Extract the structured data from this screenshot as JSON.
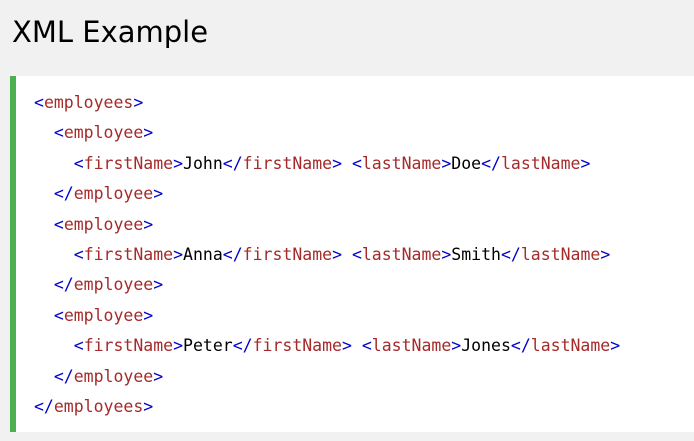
{
  "page": {
    "title": "XML Example"
  },
  "code": {
    "lines": [
      {
        "indent": 0,
        "tokens": [
          {
            "type": "b",
            "text": "<"
          },
          {
            "type": "t",
            "text": "employees"
          },
          {
            "type": "b",
            "text": ">"
          }
        ]
      },
      {
        "indent": 1,
        "tokens": [
          {
            "type": "b",
            "text": "<"
          },
          {
            "type": "t",
            "text": "employee"
          },
          {
            "type": "b",
            "text": ">"
          }
        ]
      },
      {
        "indent": 2,
        "tokens": [
          {
            "type": "b",
            "text": "<"
          },
          {
            "type": "t",
            "text": "firstName"
          },
          {
            "type": "b",
            "text": ">"
          },
          {
            "type": "x",
            "text": "John"
          },
          {
            "type": "b",
            "text": "</"
          },
          {
            "type": "t",
            "text": "firstName"
          },
          {
            "type": "b",
            "text": ">"
          },
          {
            "type": "x",
            "text": " "
          },
          {
            "type": "b",
            "text": "<"
          },
          {
            "type": "t",
            "text": "lastName"
          },
          {
            "type": "b",
            "text": ">"
          },
          {
            "type": "x",
            "text": "Doe"
          },
          {
            "type": "b",
            "text": "</"
          },
          {
            "type": "t",
            "text": "lastName"
          },
          {
            "type": "b",
            "text": ">"
          }
        ]
      },
      {
        "indent": 1,
        "tokens": [
          {
            "type": "b",
            "text": "</"
          },
          {
            "type": "t",
            "text": "employee"
          },
          {
            "type": "b",
            "text": ">"
          }
        ]
      },
      {
        "indent": 1,
        "tokens": [
          {
            "type": "b",
            "text": "<"
          },
          {
            "type": "t",
            "text": "employee"
          },
          {
            "type": "b",
            "text": ">"
          }
        ]
      },
      {
        "indent": 2,
        "tokens": [
          {
            "type": "b",
            "text": "<"
          },
          {
            "type": "t",
            "text": "firstName"
          },
          {
            "type": "b",
            "text": ">"
          },
          {
            "type": "x",
            "text": "Anna"
          },
          {
            "type": "b",
            "text": "</"
          },
          {
            "type": "t",
            "text": "firstName"
          },
          {
            "type": "b",
            "text": ">"
          },
          {
            "type": "x",
            "text": " "
          },
          {
            "type": "b",
            "text": "<"
          },
          {
            "type": "t",
            "text": "lastName"
          },
          {
            "type": "b",
            "text": ">"
          },
          {
            "type": "x",
            "text": "Smith"
          },
          {
            "type": "b",
            "text": "</"
          },
          {
            "type": "t",
            "text": "lastName"
          },
          {
            "type": "b",
            "text": ">"
          }
        ]
      },
      {
        "indent": 1,
        "tokens": [
          {
            "type": "b",
            "text": "</"
          },
          {
            "type": "t",
            "text": "employee"
          },
          {
            "type": "b",
            "text": ">"
          }
        ]
      },
      {
        "indent": 1,
        "tokens": [
          {
            "type": "b",
            "text": "<"
          },
          {
            "type": "t",
            "text": "employee"
          },
          {
            "type": "b",
            "text": ">"
          }
        ]
      },
      {
        "indent": 2,
        "tokens": [
          {
            "type": "b",
            "text": "<"
          },
          {
            "type": "t",
            "text": "firstName"
          },
          {
            "type": "b",
            "text": ">"
          },
          {
            "type": "x",
            "text": "Peter"
          },
          {
            "type": "b",
            "text": "</"
          },
          {
            "type": "t",
            "text": "firstName"
          },
          {
            "type": "b",
            "text": ">"
          },
          {
            "type": "x",
            "text": " "
          },
          {
            "type": "b",
            "text": "<"
          },
          {
            "type": "t",
            "text": "lastName"
          },
          {
            "type": "b",
            "text": ">"
          },
          {
            "type": "x",
            "text": "Jones"
          },
          {
            "type": "b",
            "text": "</"
          },
          {
            "type": "t",
            "text": "lastName"
          },
          {
            "type": "b",
            "text": ">"
          }
        ]
      },
      {
        "indent": 1,
        "tokens": [
          {
            "type": "b",
            "text": "</"
          },
          {
            "type": "t",
            "text": "employee"
          },
          {
            "type": "b",
            "text": ">"
          }
        ]
      },
      {
        "indent": 0,
        "tokens": [
          {
            "type": "b",
            "text": "</"
          },
          {
            "type": "t",
            "text": "employees"
          },
          {
            "type": "b",
            "text": ">"
          }
        ]
      }
    ]
  },
  "colors": {
    "bracket": "#0000cd",
    "tag": "#a52a2a",
    "text": "#000000",
    "accent_border": "#4caf50",
    "background": "#f1f1f1",
    "code_background": "#ffffff"
  }
}
